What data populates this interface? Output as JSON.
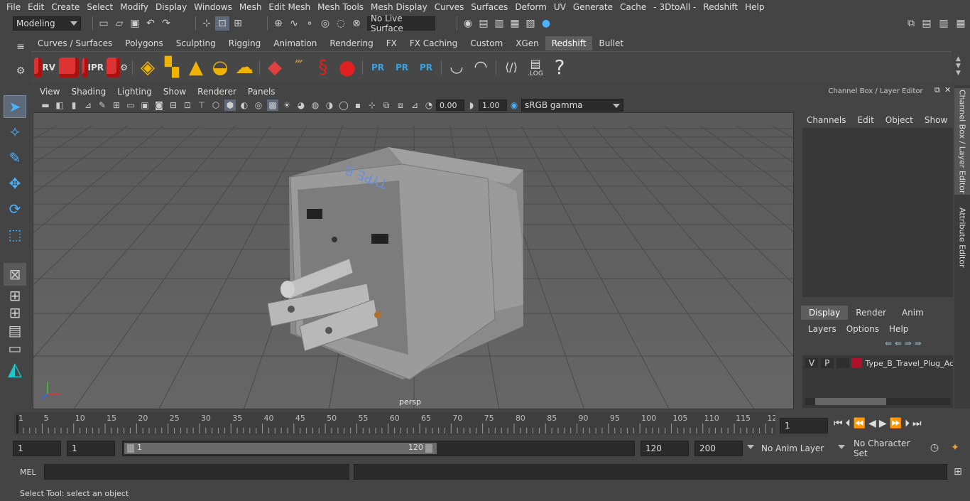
{
  "menu": [
    "File",
    "Edit",
    "Create",
    "Select",
    "Modify",
    "Display",
    "Windows",
    "Mesh",
    "Edit Mesh",
    "Mesh Tools",
    "Mesh Display",
    "Curves",
    "Surfaces",
    "Deform",
    "UV",
    "Generate",
    "Cache",
    "- 3DtoAll -",
    "Redshift",
    "Help"
  ],
  "status": {
    "mode": "Modeling",
    "live_surface": "No Live Surface"
  },
  "shelf_tabs": [
    "Curves / Surfaces",
    "Polygons",
    "Sculpting",
    "Rigging",
    "Animation",
    "Rendering",
    "FX",
    "FX Caching",
    "Custom",
    "XGen",
    "Redshift",
    "Bullet"
  ],
  "active_shelf": "Redshift",
  "shelf_labels": {
    "rv": "RV",
    "ipr": "IPR",
    "pr": "PR",
    "log": ".LOG",
    "help": "?"
  },
  "viewport": {
    "menu": [
      "View",
      "Shading",
      "Lighting",
      "Show",
      "Renderer",
      "Panels"
    ],
    "exposure": "0.00",
    "gamma": "1.00",
    "color_space": "sRGB gamma",
    "camera": "persp",
    "model_text": "TYPE B"
  },
  "channel_box": {
    "title": "Channel Box / Layer Editor",
    "menu": [
      "Channels",
      "Edit",
      "Object",
      "Show"
    ]
  },
  "layer_editor": {
    "tabs": [
      "Display",
      "Render",
      "Anim"
    ],
    "active_tab": "Display",
    "menu": [
      "Layers",
      "Options",
      "Help"
    ],
    "layer": {
      "v": "V",
      "p": "P",
      "name": "Type_B_Travel_Plug_Ac",
      "color": "#b0102a"
    }
  },
  "side_tabs": [
    "Channel Box / Layer Editor",
    "Attribute Editor"
  ],
  "timeline": {
    "ticks": [
      "1",
      "5",
      "10",
      "15",
      "20",
      "25",
      "30",
      "35",
      "40",
      "45",
      "50",
      "55",
      "60",
      "65",
      "70",
      "75",
      "80",
      "85",
      "90",
      "95",
      "100",
      "105",
      "110",
      "115",
      "12"
    ],
    "current_frame": "1"
  },
  "range": {
    "start": "1",
    "playback_start": "1",
    "slider_start": "1",
    "slider_end": "120",
    "playback_end": "120",
    "end": "200",
    "anim_layer": "No Anim Layer",
    "char_set": "No Character Set"
  },
  "mel": {
    "label": "MEL"
  },
  "help_line": "Select Tool: select an object"
}
